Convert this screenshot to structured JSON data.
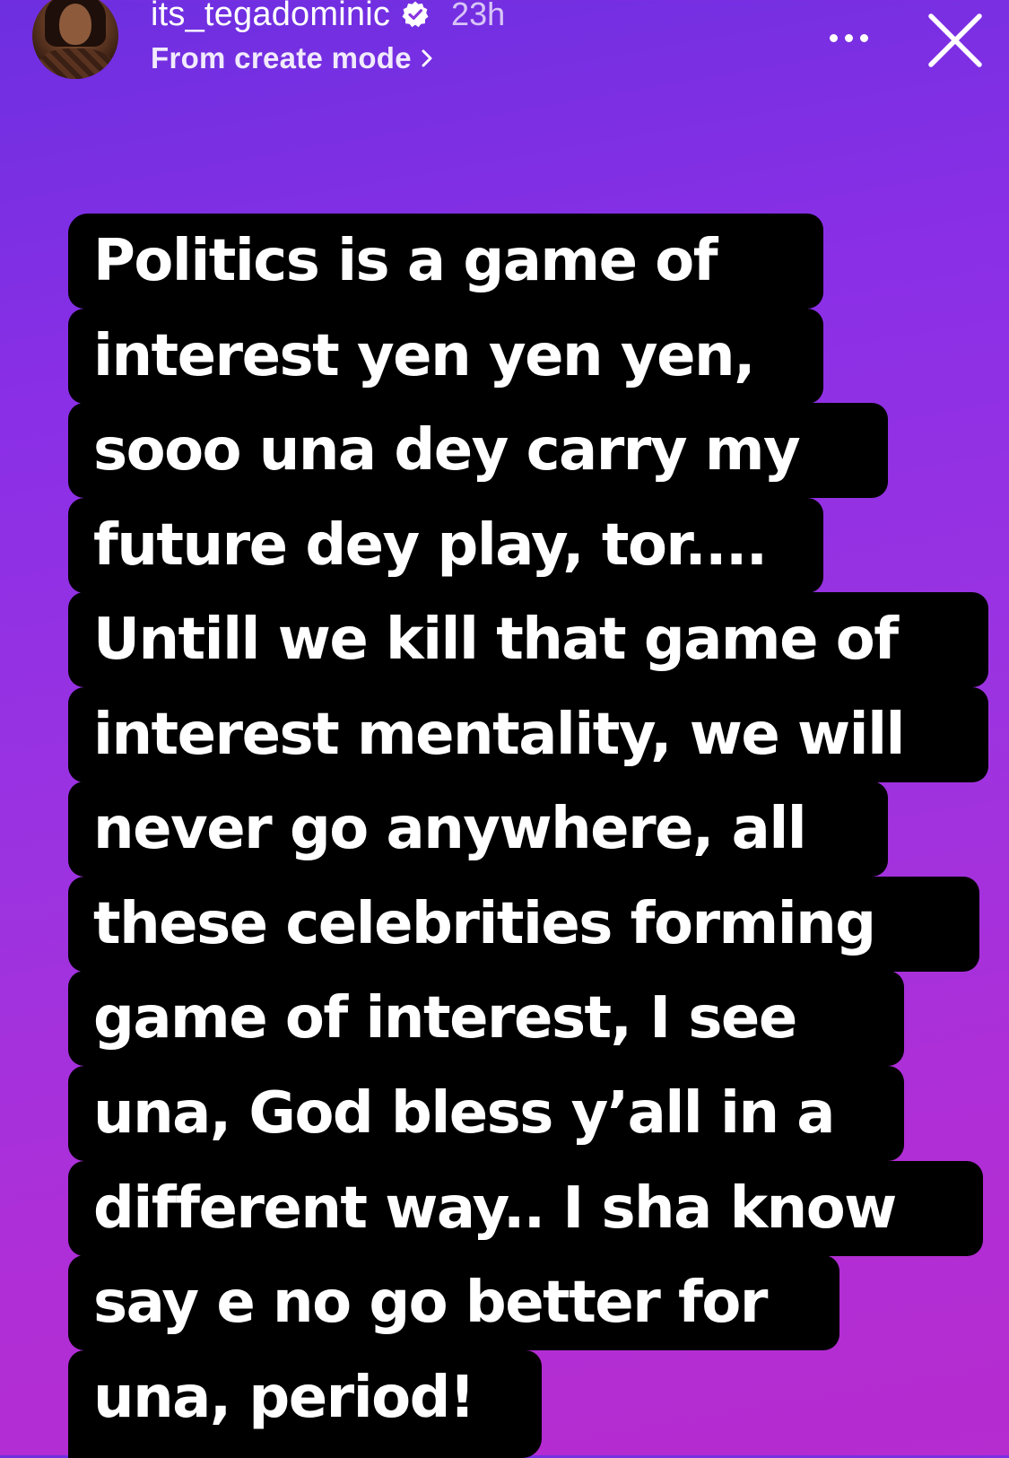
{
  "header": {
    "username": "its_tegadominic",
    "time_ago": "23h",
    "source": "From create mode",
    "avatar": "profile-photo",
    "icons": {
      "verified": "verified-badge-icon",
      "more": "more-options-icon",
      "close": "close-icon",
      "chevron": "chevron-right-icon"
    }
  },
  "story": {
    "lines": [
      "Politics is a game of",
      "interest yen yen yen,",
      "sooo una dey carry my",
      "future dey play, tor....",
      "Untill we kill that game of",
      "interest mentality, we will",
      "never go anywhere, all",
      "these celebrities forming",
      "game of interest, I see",
      "una, God bless y’all in a",
      "different way.. I sha know",
      "say e no go better for",
      "una, period!"
    ]
  },
  "colors": {
    "background_top": "#6d2fe0",
    "background_bottom": "#b52ccf",
    "text_highlight": "#000000",
    "text": "#ffffff"
  }
}
